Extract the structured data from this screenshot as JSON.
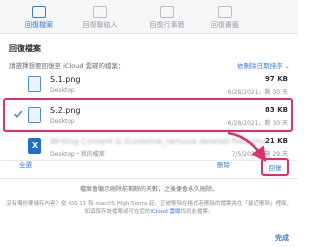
{
  "tabs": [
    {
      "label": "回復檔案",
      "active": true,
      "icon": "folder-restore-icon"
    },
    {
      "label": "回復聯絡人",
      "active": false,
      "icon": "contacts-icon"
    },
    {
      "label": "回復行事曆",
      "active": false,
      "icon": "calendar-icon"
    },
    {
      "label": "回復書籤",
      "active": false,
      "icon": "bookmark-icon"
    }
  ],
  "heading": "回復檔案",
  "prompt": "請選擇想要回復至 iCloud 雲碟的檔案：",
  "sort_label": "依刪除日期排序 ⌄",
  "files": [
    {
      "name": "S.1.png",
      "folder": "Desktop",
      "size": "97 KB",
      "date": "6/28/2021，剩 30 天",
      "selected": false,
      "type": "png",
      "obscured": false
    },
    {
      "name": "S.2.png",
      "folder": "Desktop",
      "size": "83 KB",
      "date": "6/28/2021，剩 30 天",
      "selected": true,
      "type": "png",
      "obscured": false
    },
    {
      "name": "Writing Content & Guideline_remove deleted files.xlsx",
      "folder": "Desktop・我的檔案",
      "size": "21 KB",
      "date": "7/5/2021，剩 29 天",
      "selected": false,
      "type": "xlsx",
      "obscured": true
    }
  ],
  "actions": {
    "select_all": "全選",
    "delete": "刪除",
    "restore": "回復"
  },
  "note1": "檔案會顯示刪除前剩餘的天數，之後便會永久刪除。",
  "note2_a": "沒有備份要儲存內容？從 iOS 11 和 macOS High Sierra 起，正被刪除在格式若刪除的檔案為在「最近刪除」裡面，如須保存該檔案或可在您的",
  "note2_link": "iCloud 雲碟",
  "note2_b": "找到此檔案。",
  "done": "完成",
  "colors": {
    "accent": "#3a7bd5",
    "highlight": "#d8326e"
  }
}
